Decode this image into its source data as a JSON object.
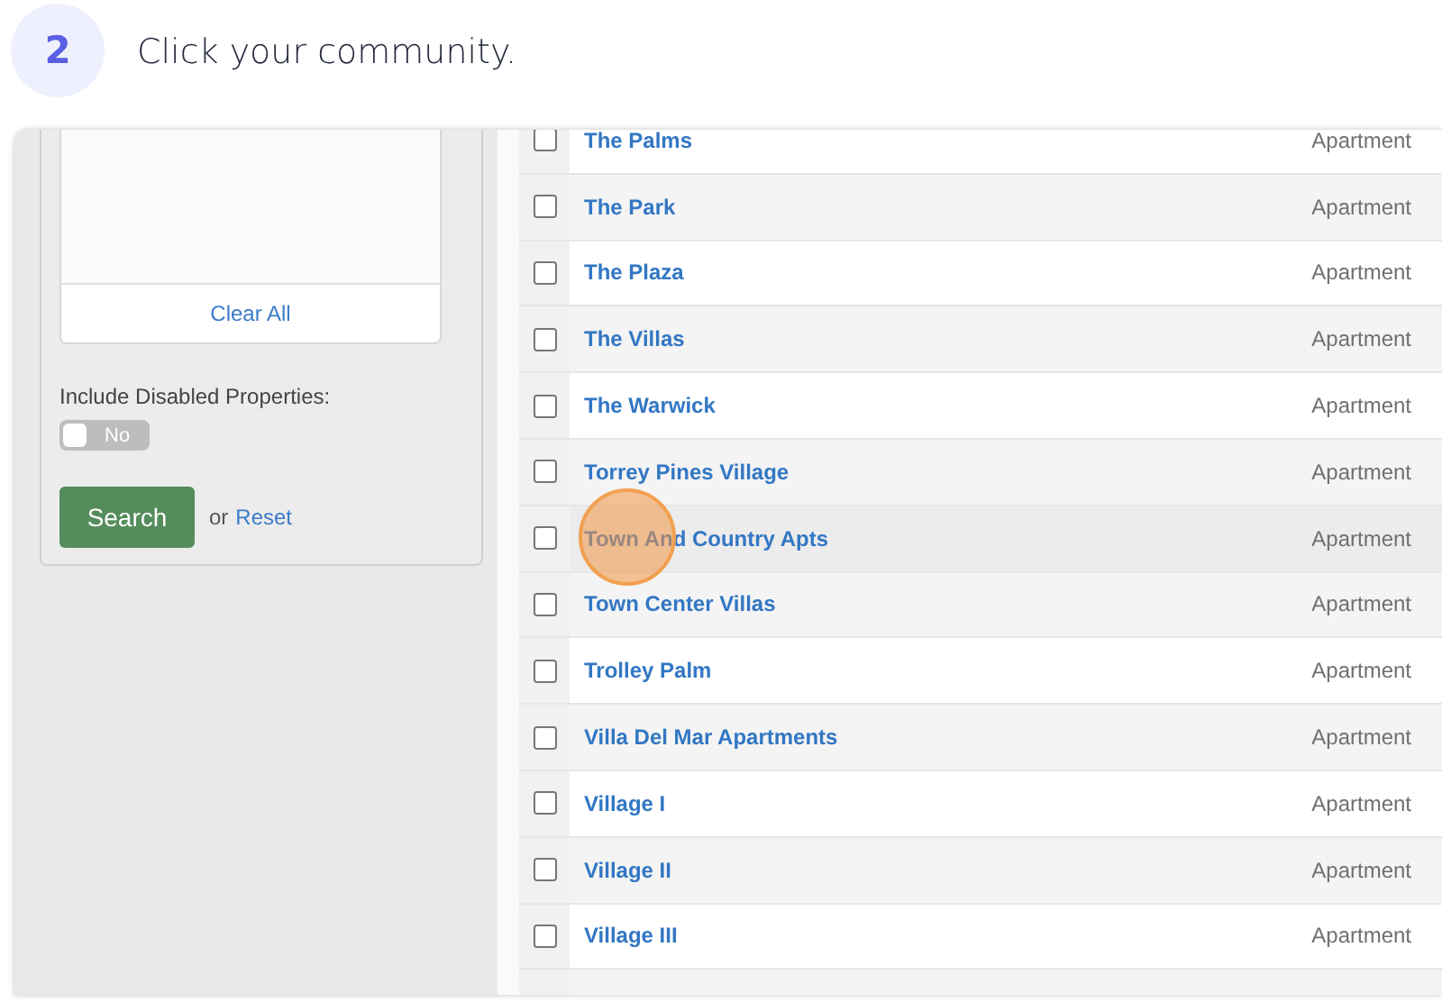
{
  "step": {
    "number": "2",
    "instruction": "Click your community."
  },
  "filter_panel": {
    "clear_button": "Clear All",
    "disabled_label": "Include Disabled Properties:",
    "disabled_toggle": {
      "label": "No",
      "on": false
    },
    "search_button": "Search",
    "or_text": "or",
    "reset_link": "Reset"
  },
  "rows": [
    {
      "name": "The Palms",
      "type": "Apartment",
      "checked": false,
      "highlighted": false
    },
    {
      "name": "The Park",
      "type": "Apartment",
      "checked": false,
      "highlighted": false
    },
    {
      "name": "The Plaza",
      "type": "Apartment",
      "checked": false,
      "highlighted": false
    },
    {
      "name": "The Villas",
      "type": "Apartment",
      "checked": false,
      "highlighted": false
    },
    {
      "name": "The Warwick",
      "type": "Apartment",
      "checked": false,
      "highlighted": false
    },
    {
      "name": "Torrey Pines Village",
      "type": "Apartment",
      "checked": false,
      "highlighted": false
    },
    {
      "name": "Town And Country Apts",
      "type": "Apartment",
      "checked": false,
      "highlighted": true
    },
    {
      "name": "Town Center Villas",
      "type": "Apartment",
      "checked": false,
      "highlighted": false
    },
    {
      "name": "Trolley Palm",
      "type": "Apartment",
      "checked": false,
      "highlighted": false
    },
    {
      "name": "Villa Del Mar Apartments",
      "type": "Apartment",
      "checked": false,
      "highlighted": false
    },
    {
      "name": "Village I",
      "type": "Apartment",
      "checked": false,
      "highlighted": false
    },
    {
      "name": "Village II",
      "type": "Apartment",
      "checked": false,
      "highlighted": false
    },
    {
      "name": "Village III",
      "type": "Apartment",
      "checked": false,
      "highlighted": false
    }
  ]
}
